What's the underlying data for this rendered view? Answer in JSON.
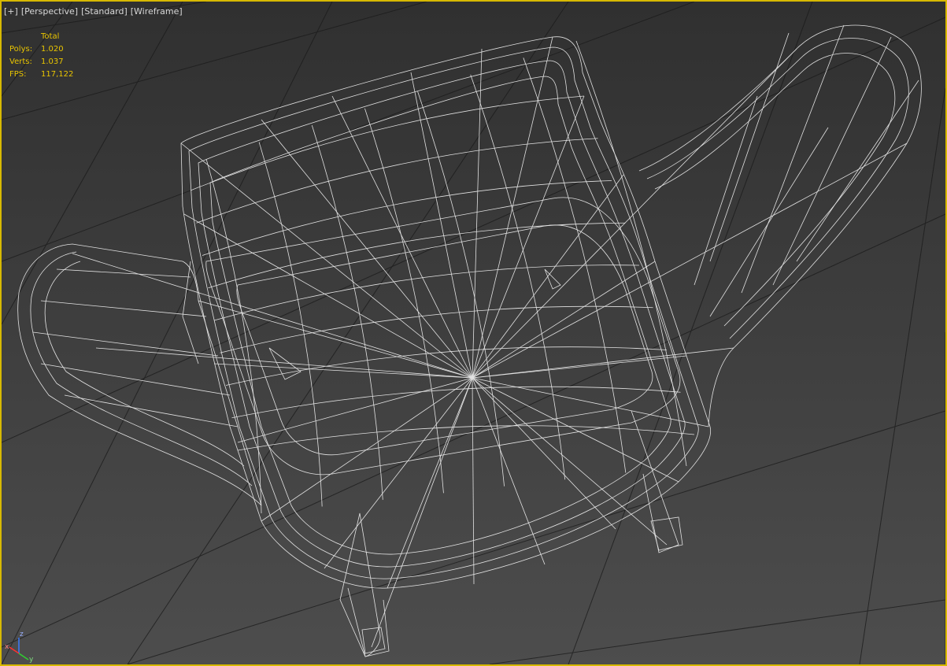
{
  "viewport_menu": {
    "plus": "[+]",
    "view": "[Perspective]",
    "shading": "[Standard]",
    "display": "[Wireframe]"
  },
  "stats": {
    "column_header": "Total",
    "polys_label": "Polys:",
    "polys_value": "1.020",
    "verts_label": "Verts:",
    "verts_value": "1.037",
    "fps_label": "FPS:",
    "fps_value": "117,122"
  },
  "axis_gizmo": {
    "z": "z",
    "x": "x",
    "y": "y"
  },
  "colors": {
    "hud_text": "#e8c400",
    "viewport_border": "#d7b900",
    "wireframe": "#ffffff",
    "grid": "#1a1a1a"
  }
}
